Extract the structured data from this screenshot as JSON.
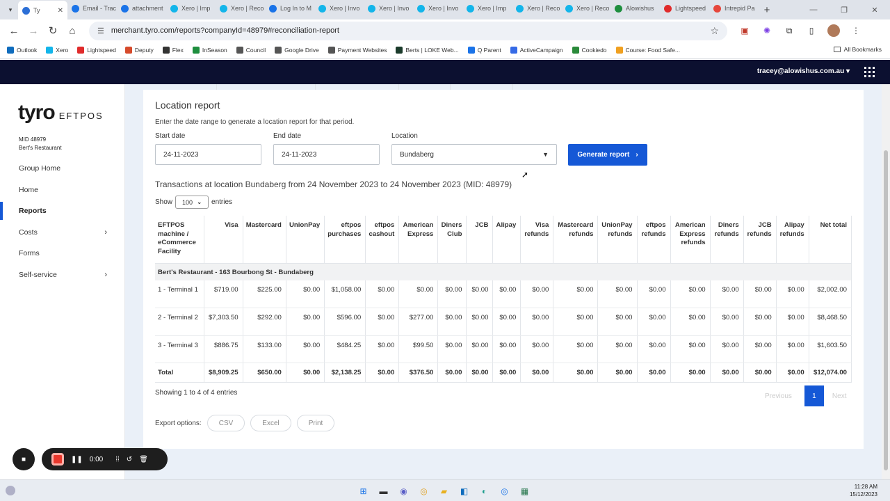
{
  "browser": {
    "tabs": [
      {
        "label": "Ty",
        "active": true,
        "color": "#2c6fd6"
      },
      {
        "label": "Email - Trac",
        "color": "#1a73e8"
      },
      {
        "label": "attachment",
        "color": "#1a73e8"
      },
      {
        "label": "Xero | Imp",
        "color": "#13b5ea"
      },
      {
        "label": "Xero | Reco",
        "color": "#13b5ea"
      },
      {
        "label": "Log In to M",
        "color": "#1a73e8"
      },
      {
        "label": "Xero | Invo",
        "color": "#13b5ea"
      },
      {
        "label": "Xero | Invo",
        "color": "#13b5ea"
      },
      {
        "label": "Xero | Invo",
        "color": "#13b5ea"
      },
      {
        "label": "Xero | Imp",
        "color": "#13b5ea"
      },
      {
        "label": "Xero | Reco",
        "color": "#13b5ea"
      },
      {
        "label": "Xero | Reco",
        "color": "#13b5ea"
      },
      {
        "label": "Alowishus",
        "color": "#1e8e3e"
      },
      {
        "label": "Lightspeed",
        "color": "#e02b2b"
      },
      {
        "label": "Intrepid Pa",
        "color": "#e6463b"
      }
    ],
    "url": "merchant.tyro.com/reports?companyId=48979#reconciliation-report",
    "bookmarks": [
      {
        "label": "Outlook",
        "color": "#0f6cbd"
      },
      {
        "label": "Xero",
        "color": "#13b5ea"
      },
      {
        "label": "Lightspeed",
        "color": "#e02b2b"
      },
      {
        "label": "Deputy",
        "color": "#d64a2b"
      },
      {
        "label": "Flex",
        "color": "#333333"
      },
      {
        "label": "InSeason",
        "color": "#1e8e3e"
      },
      {
        "label": "Council",
        "color": "#555555"
      },
      {
        "label": "Google Drive",
        "color": "#555555"
      },
      {
        "label": "Payment Websites",
        "color": "#555555"
      },
      {
        "label": "Berts | LOKE Web...",
        "color": "#1b3b2b"
      },
      {
        "label": "Q Parent",
        "color": "#1a73e8"
      },
      {
        "label": "ActiveCampaign",
        "color": "#356ae6"
      },
      {
        "label": "Cookiedo",
        "color": "#2a8a3a"
      },
      {
        "label": "Course: Food Safe...",
        "color": "#f0a020"
      }
    ],
    "all_bookmarks": "All Bookmarks"
  },
  "header": {
    "user_email": "tracey@alowishus.com.au"
  },
  "sidebar": {
    "logo_main": "tyro",
    "logo_sub": "EFTPOS",
    "mid_line1": "MID 48979",
    "mid_line2": "Bert's Restaurant",
    "items": [
      {
        "label": "Group Home"
      },
      {
        "label": "Home"
      },
      {
        "label": "Reports",
        "active": true
      },
      {
        "label": "Costs",
        "has_chevron": true
      },
      {
        "label": "Forms"
      },
      {
        "label": "Self-service",
        "has_chevron": true
      }
    ]
  },
  "report": {
    "title": "Location report",
    "subtitle": "Enter the date range to generate a location report for that period.",
    "start_label": "Start date",
    "start_value": "24-11-2023",
    "end_label": "End date",
    "end_value": "24-11-2023",
    "location_label": "Location",
    "location_value": "Bundaberg",
    "generate_label": "Generate report",
    "heading": "Transactions at location Bundaberg from 24 November 2023 to 24 November 2023 (MID: 48979)",
    "show_label": "Show",
    "show_value": "100",
    "entries_label": "entries",
    "columns": [
      "EFTPOS machine / eCommerce Facility",
      "Visa",
      "Mastercard",
      "UnionPay",
      "eftpos purchases",
      "eftpos cashout",
      "American Express",
      "Diners Club",
      "JCB",
      "Alipay",
      "Visa refunds",
      "Mastercard refunds",
      "UnionPay refunds",
      "eftpos refunds",
      "American Express refunds",
      "Diners refunds",
      "JCB refunds",
      "Alipay refunds",
      "Net total"
    ],
    "group": "Bert's Restaurant - 163 Bourbong St - Bundaberg",
    "rows": [
      [
        "1 - Terminal 1",
        "$719.00",
        "$225.00",
        "$0.00",
        "$1,058.00",
        "$0.00",
        "$0.00",
        "$0.00",
        "$0.00",
        "$0.00",
        "$0.00",
        "$0.00",
        "$0.00",
        "$0.00",
        "$0.00",
        "$0.00",
        "$0.00",
        "$0.00",
        "$2,002.00"
      ],
      [
        "2 - Terminal 2",
        "$7,303.50",
        "$292.00",
        "$0.00",
        "$596.00",
        "$0.00",
        "$277.00",
        "$0.00",
        "$0.00",
        "$0.00",
        "$0.00",
        "$0.00",
        "$0.00",
        "$0.00",
        "$0.00",
        "$0.00",
        "$0.00",
        "$0.00",
        "$8,468.50"
      ],
      [
        "3 - Terminal 3",
        "$886.75",
        "$133.00",
        "$0.00",
        "$484.25",
        "$0.00",
        "$99.50",
        "$0.00",
        "$0.00",
        "$0.00",
        "$0.00",
        "$0.00",
        "$0.00",
        "$0.00",
        "$0.00",
        "$0.00",
        "$0.00",
        "$0.00",
        "$1,603.50"
      ]
    ],
    "total": [
      "Total",
      "$8,909.25",
      "$650.00",
      "$0.00",
      "$2,138.25",
      "$0.00",
      "$376.50",
      "$0.00",
      "$0.00",
      "$0.00",
      "$0.00",
      "$0.00",
      "$0.00",
      "$0.00",
      "$0.00",
      "$0.00",
      "$0.00",
      "$0.00",
      "$12,074.00"
    ],
    "showing": "Showing 1 to 4 of 4 entries",
    "prev_label": "Previous",
    "page": "1",
    "next_label": "Next",
    "export_label": "Export options:",
    "export_buttons": [
      "CSV",
      "Excel",
      "Print"
    ]
  },
  "recorder": {
    "timer": "0:00"
  },
  "taskbar": {
    "time": "11:28 AM",
    "date": "15/12/2023"
  }
}
